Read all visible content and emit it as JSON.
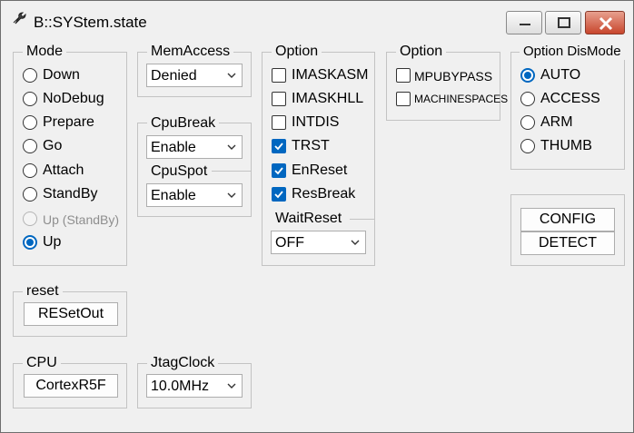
{
  "window": {
    "title": "B::SYStem.state"
  },
  "icons": {
    "app": "wrench-icon",
    "minimize": "minimize-icon",
    "maximize": "maximize-icon",
    "close": "close-icon",
    "dropdown": "chevron-down-icon",
    "check": "checkmark-icon"
  },
  "colors": {
    "accent": "#0067c0",
    "close_button": "#c8462d"
  },
  "mode": {
    "legend": "Mode",
    "options": [
      "Down",
      "NoDebug",
      "Prepare",
      "Go",
      "Attach",
      "StandBy",
      "Up (StandBy)",
      "Up"
    ],
    "selected": "Up",
    "disabled": [
      "Up (StandBy)"
    ]
  },
  "memaccess": {
    "legend": "MemAccess",
    "value": "Denied"
  },
  "cpubreak": {
    "legend": "CpuBreak",
    "value": "Enable"
  },
  "cpuspot": {
    "legend": "CpuSpot",
    "value": "Enable"
  },
  "option1": {
    "legend": "Option",
    "items": [
      {
        "label": "IMASKASM",
        "checked": false
      },
      {
        "label": "IMASKHLL",
        "checked": false
      },
      {
        "label": "INTDIS",
        "checked": false
      },
      {
        "label": "TRST",
        "checked": true
      },
      {
        "label": "EnReset",
        "checked": true
      },
      {
        "label": "ResBreak",
        "checked": true
      }
    ]
  },
  "waitreset": {
    "legend": "WaitReset",
    "value": "OFF"
  },
  "option2": {
    "legend": "Option",
    "items": [
      {
        "label": "MPUBYPASS",
        "checked": false
      },
      {
        "label": "MACHINESPACES",
        "checked": false
      }
    ]
  },
  "dismode": {
    "legend": "Option DisMode",
    "options": [
      "AUTO",
      "ACCESS",
      "ARM",
      "THUMB"
    ],
    "selected": "AUTO"
  },
  "actions": {
    "config": "CONFIG",
    "detect": "DETECT"
  },
  "reset": {
    "legend": "reset",
    "button": "RESetOut"
  },
  "cpu": {
    "legend": "CPU",
    "button": "CortexR5F"
  },
  "jtagclock": {
    "legend": "JtagClock",
    "value": "10.0MHz"
  }
}
